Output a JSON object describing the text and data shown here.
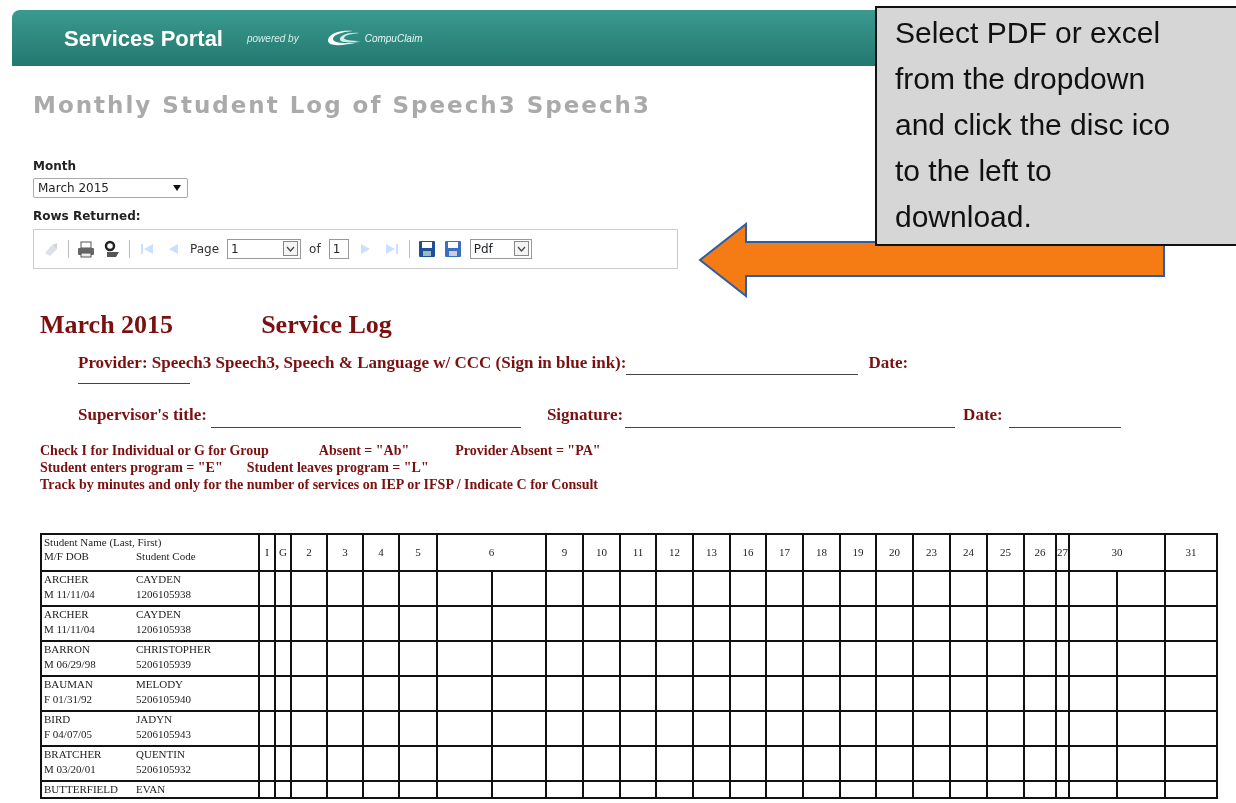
{
  "header": {
    "title": "Services Portal",
    "powered_by": "powered by",
    "brand": "CompuClaim"
  },
  "page_title": "Monthly Student Log of Speech3 Speech3",
  "month": {
    "label": "Month",
    "value": "March 2015"
  },
  "rows_returned": {
    "label": "Rows Returned:"
  },
  "toolbar": {
    "items": [
      {
        "kind": "refresh",
        "disabled": true
      },
      {
        "kind": "separator"
      },
      {
        "kind": "print",
        "disabled": false
      },
      {
        "kind": "find",
        "disabled": false
      },
      {
        "kind": "separator"
      },
      {
        "kind": "first",
        "disabled": true
      },
      {
        "kind": "prev",
        "disabled": true
      },
      {
        "kind": "page_label",
        "text": "Page"
      },
      {
        "kind": "page_field",
        "value": "1"
      },
      {
        "kind": "of_label",
        "text": "of"
      },
      {
        "kind": "total_field",
        "value": "1"
      },
      {
        "kind": "next",
        "disabled": true
      },
      {
        "kind": "last",
        "disabled": true
      },
      {
        "kind": "separator"
      },
      {
        "kind": "save",
        "disabled": false
      },
      {
        "kind": "save_as",
        "disabled": false
      },
      {
        "kind": "format_select",
        "value": "Pdf"
      }
    ]
  },
  "callout": {
    "lines": [
      "Select PDF or excel",
      "from the dropdown",
      "and click the disc ico",
      "to the left to",
      "download."
    ]
  },
  "report": {
    "month": "March  2015",
    "title": "Service Log",
    "provider": "Provider: Speech3 Speech3, Speech & Language w/ CCC  (Sign in blue ink):",
    "date_label": "Date:",
    "supervisor_title": "Supervisor's title:",
    "signature": "Signature:",
    "date_label_2": "Date:",
    "legend": [
      [
        "Check I for Individual or G for Group",
        "Absent = \"Ab\"",
        "Provider Absent = \"PA\""
      ],
      [
        "Student enters program = \"E\"",
        "Student leaves program = \"L\""
      ],
      [
        "Track by minutes and only for the number of services on IEP or IFSP / Indicate C for Consult"
      ]
    ]
  },
  "table": {
    "name_header": {
      "line1": "Student Name (Last, First)",
      "sex_dob": "M/F   DOB",
      "code": "Student Code"
    },
    "columns": [
      "I",
      "G",
      "2",
      "3",
      "4",
      "5",
      "6",
      "9",
      "10",
      "11",
      "12",
      "13",
      "16",
      "17",
      "18",
      "19",
      "20",
      "23",
      "24",
      "25",
      "26",
      "27",
      "30",
      "31"
    ],
    "rows": [
      {
        "last": "ARCHER",
        "first": "CAYDEN",
        "sex_dob": "M 11/11/04",
        "code": "1206105938"
      },
      {
        "last": "ARCHER",
        "first": "CAYDEN",
        "sex_dob": "M 11/11/04",
        "code": "1206105938"
      },
      {
        "last": "BARRON",
        "first": "CHRISTOPHER",
        "sex_dob": "M 06/29/98",
        "code": "5206105939"
      },
      {
        "last": "BAUMAN",
        "first": "MELODY",
        "sex_dob": "F  01/31/92",
        "code": "5206105940"
      },
      {
        "last": "BIRD",
        "first": "JADYN",
        "sex_dob": "F  04/07/05",
        "code": "5206105943"
      },
      {
        "last": "BRATCHER",
        "first": "QUENTIN",
        "sex_dob": "M 03/20/01",
        "code": "5206105932"
      },
      {
        "last": "BUTTERFIELD",
        "first": "EVAN"
      }
    ]
  }
}
